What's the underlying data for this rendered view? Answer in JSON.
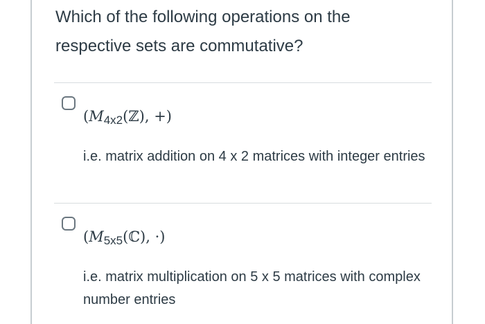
{
  "question": {
    "text": "Which of the following operations on the respective sets are commutative?"
  },
  "answers": [
    {
      "math_symbol": "M",
      "math_subscript": "4x2",
      "math_rest": "(ℤ), +)",
      "math_open": "(",
      "description": "i.e. matrix addition on 4 x 2 matrices with integer entries",
      "checked": false
    },
    {
      "math_symbol": "M",
      "math_subscript": "5x5",
      "math_rest": "(ℂ), ·)",
      "math_open": "(",
      "description": "i.e. matrix multiplication on 5 x 5 matrices with complex number entries",
      "checked": false
    }
  ],
  "colors": {
    "text": "#2d3b45",
    "border": "#c7cdd1",
    "divider": "#d8dcdf",
    "checkbox_border": "#6b7780"
  }
}
